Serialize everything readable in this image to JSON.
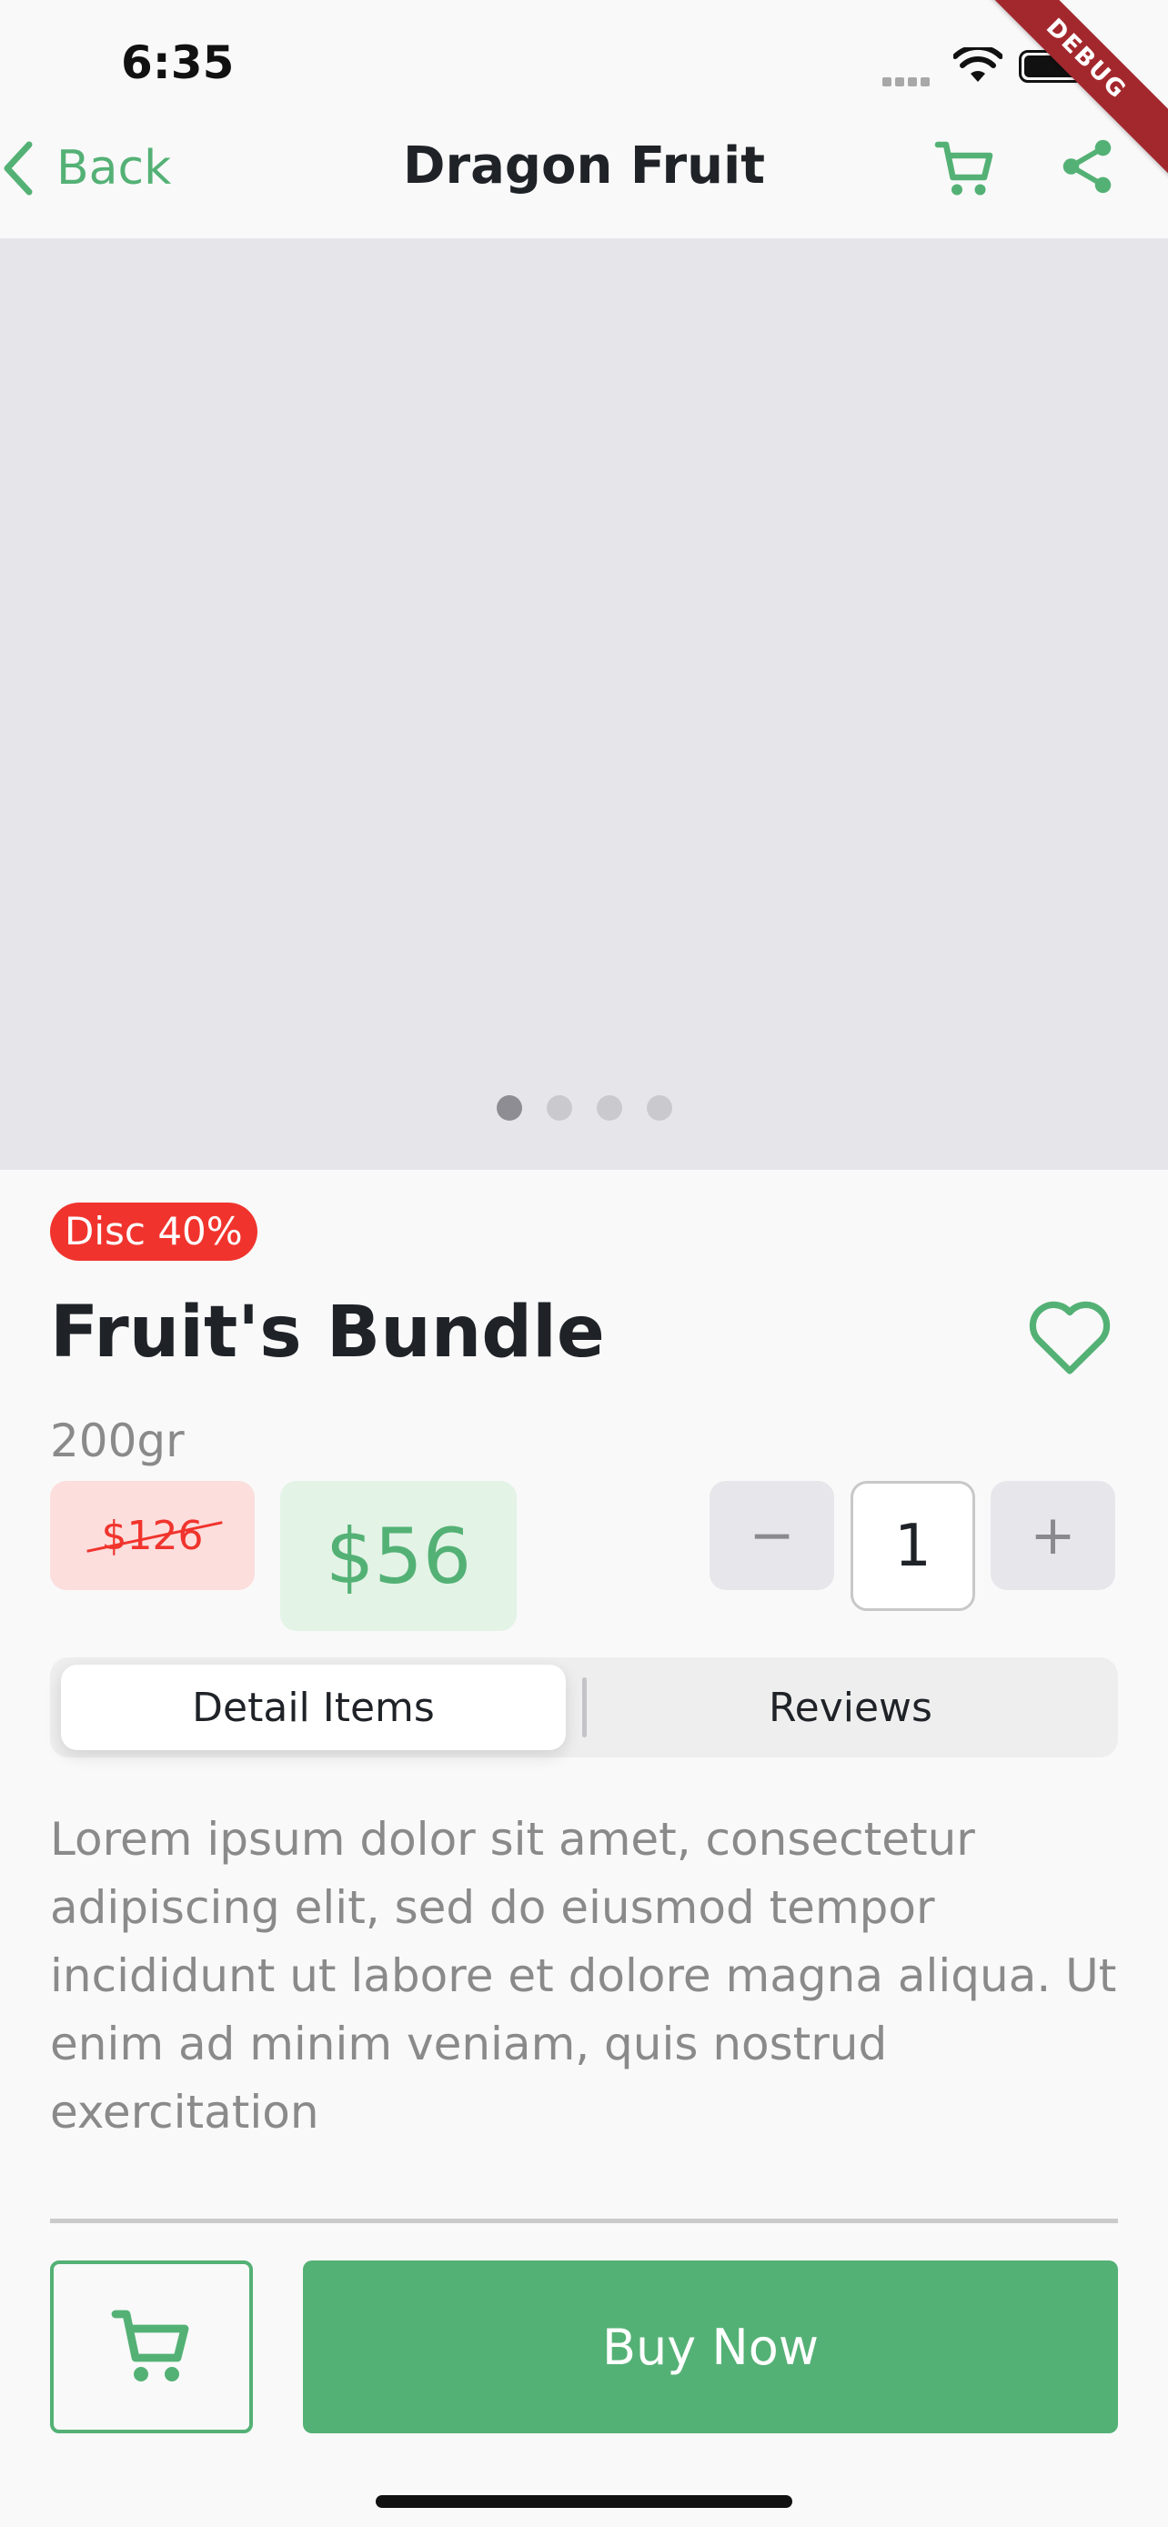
{
  "status_bar": {
    "time": "6:35"
  },
  "debug_banner": "DEBUG",
  "nav": {
    "back_label": "Back",
    "title": "Dragon Fruit",
    "icons": [
      "cart-icon",
      "share-icon"
    ]
  },
  "carousel": {
    "page_count": 4,
    "active_index": 0
  },
  "product": {
    "discount_badge": "Disc 40%",
    "name": "Fruit's Bundle",
    "weight": "200gr",
    "original_price": "$126",
    "price": "$56",
    "quantity": "1",
    "qty_minus": "−",
    "qty_plus": "+"
  },
  "tabs": [
    {
      "label": "Detail Items",
      "active": true
    },
    {
      "label": "Reviews",
      "active": false
    }
  ],
  "description": "Lorem ipsum dolor sit amet, consectetur adipiscing elit, sed do eiusmod tempor incididunt ut labore et dolore magna aliqua. Ut enim ad minim veniam, quis nostrud exercitation",
  "actions": {
    "buy_now_label": "Buy Now"
  },
  "colors": {
    "accent": "#54b175",
    "discount": "#f0342d",
    "image_placeholder": "#e6e5ea"
  }
}
